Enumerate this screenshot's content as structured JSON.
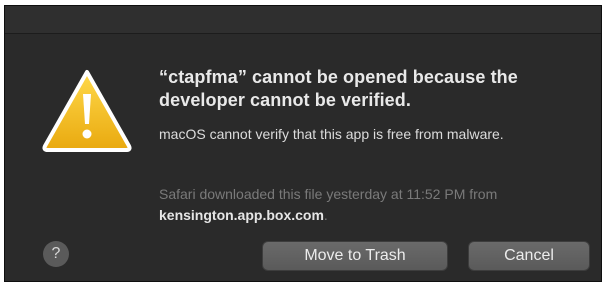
{
  "alert": {
    "title": "“ctapfma” cannot be opened because the developer cannot be verified.",
    "message": "macOS cannot verify that this app is free from malware.",
    "source_text": "Safari downloaded this file yesterday at 11:52 PM from",
    "source_host": "kensington.app.box.com",
    "source_period": ".",
    "icon": "warning-icon",
    "help_label": "?",
    "buttons": {
      "move_to_trash": "Move to Trash",
      "cancel": "Cancel"
    }
  },
  "colors": {
    "dialog_background": "#2a2a2a",
    "warning_yellow": "#f2c12e",
    "button_gray": "#5f5f5f"
  }
}
